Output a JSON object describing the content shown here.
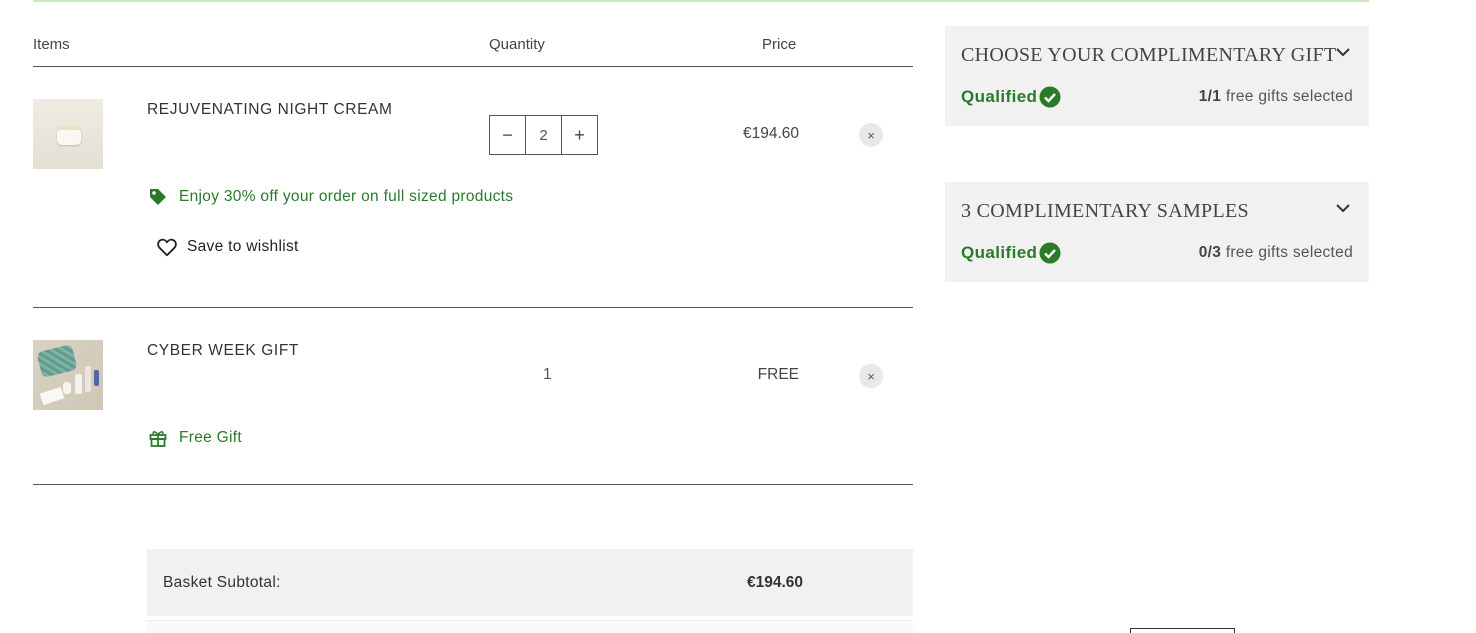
{
  "header": {
    "items_label": "Items",
    "quantity_label": "Quantity",
    "price_label": "Price"
  },
  "items": [
    {
      "name": "REJUVENATING NIGHT CREAM",
      "quantity": "2",
      "price": "€194.60",
      "promo": "Enjoy 30% off your order on full sized products",
      "wishlist_label": "Save to wishlist",
      "remove_symbol": "×"
    },
    {
      "name": "CYBER WEEK GIFT",
      "quantity": "1",
      "price": "FREE",
      "promo": "Free Gift",
      "remove_symbol": "×"
    }
  ],
  "stepper": {
    "minus": "−",
    "plus": "+"
  },
  "subtotal": {
    "label": "Basket Subtotal:",
    "amount": "€194.60"
  },
  "panels": [
    {
      "title": "CHOOSE YOUR COMPLIMENTARY GIFT",
      "status": "Qualified",
      "selected": "1/1",
      "selected_suffix": "free gifts selected"
    },
    {
      "title": "3 COMPLIMENTARY SAMPLES",
      "status": "Qualified",
      "selected": "0/3",
      "selected_suffix": "free gifts selected"
    }
  ],
  "colors": {
    "accent_green": "#2a7a2a",
    "panel_bg": "#f1f1f1"
  },
  "icons": {
    "promo_tag": "tag-icon",
    "free_gift": "gift-icon",
    "wishlist": "heart-icon",
    "qualified": "check-circle-icon",
    "expand": "chevron-down-icon",
    "remove": "close-icon"
  }
}
